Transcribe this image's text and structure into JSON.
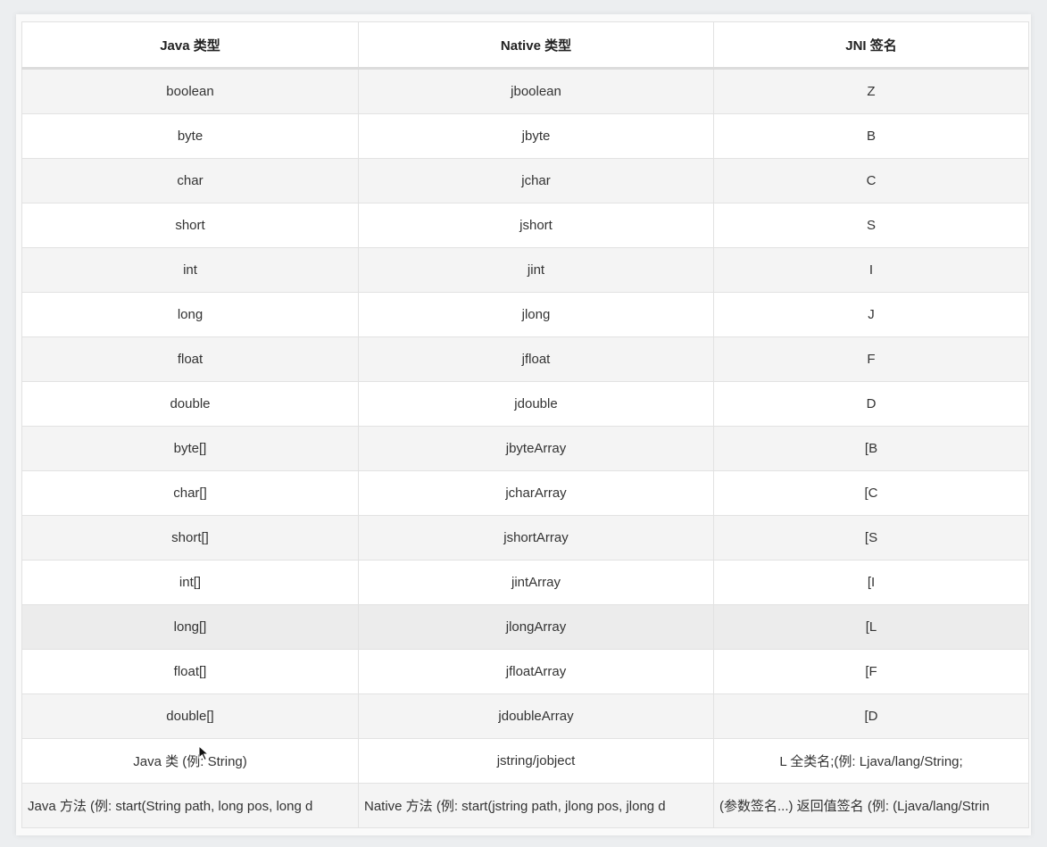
{
  "table": {
    "headers": [
      "Java 类型",
      "Native 类型",
      "JNI 签名"
    ],
    "rows": [
      [
        "boolean",
        "jboolean",
        "Z"
      ],
      [
        "byte",
        "jbyte",
        "B"
      ],
      [
        "char",
        "jchar",
        "C"
      ],
      [
        "short",
        "jshort",
        "S"
      ],
      [
        "int",
        "jint",
        "I"
      ],
      [
        "long",
        "jlong",
        "J"
      ],
      [
        "float",
        "jfloat",
        "F"
      ],
      [
        "double",
        "jdouble",
        "D"
      ],
      [
        "byte[]",
        "jbyteArray",
        "[B"
      ],
      [
        "char[]",
        "jcharArray",
        "[C"
      ],
      [
        "short[]",
        "jshortArray",
        "[S"
      ],
      [
        "int[]",
        "jintArray",
        "[I"
      ],
      [
        "long[]",
        "jlongArray",
        "[L"
      ],
      [
        "float[]",
        "jfloatArray",
        "[F"
      ],
      [
        "double[]",
        "jdoubleArray",
        "[D"
      ],
      [
        "Java 类 (例: String)",
        "jstring/jobject",
        "L 全类名;(例: Ljava/lang/String;"
      ],
      [
        "Java 方法 (例: start(String path, long pos, long d",
        "Native 方法 (例: start(jstring path, jlong pos, jlong d",
        "(参数签名...) 返回值签名 (例: (Ljava/lang/Strin"
      ]
    ]
  },
  "cursor": {
    "icon": "mouse-pointer-icon"
  }
}
